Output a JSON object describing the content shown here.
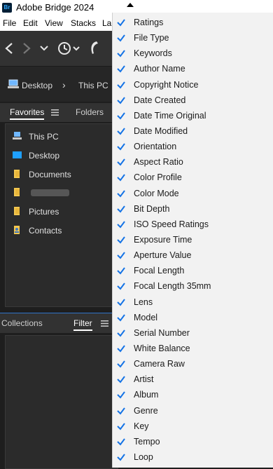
{
  "app": {
    "title": "Adobe Bridge 2024",
    "icon_text": "Br"
  },
  "menubar": {
    "items": [
      "File",
      "Edit",
      "View",
      "Stacks",
      "La"
    ]
  },
  "toolbar": {
    "icons": [
      "back-arrow-icon",
      "forward-arrow-icon",
      "chevron-down-icon",
      "history-icon",
      "boomerang-icon"
    ]
  },
  "path": {
    "desktop": "Desktop",
    "separator": "›",
    "this_pc": "This PC"
  },
  "panels": {
    "favorites_tab": "Favorites",
    "folders_tab": "Folders",
    "collections_tab": "Collections",
    "filter_tab": "Filter"
  },
  "favorites": [
    {
      "label": "This PC",
      "icon": "computer-icon"
    },
    {
      "label": "Desktop",
      "icon": "desktop-icon"
    },
    {
      "label": "Documents",
      "icon": "folder-icon"
    },
    {
      "label": "",
      "icon": "folder-icon"
    },
    {
      "label": "Pictures",
      "icon": "folder-icon"
    },
    {
      "label": "Contacts",
      "icon": "contacts-icon"
    }
  ],
  "dropdown": {
    "items": [
      "Ratings",
      "File Type",
      "Keywords",
      "Author Name",
      "Copyright Notice",
      "Date Created",
      "Date Time Original",
      "Date Modified",
      "Orientation",
      "Aspect Ratio",
      "Color Profile",
      "Color Mode",
      "Bit Depth",
      "ISO Speed Ratings",
      "Exposure Time",
      "Aperture Value",
      "Focal Length",
      "Focal Length 35mm",
      "Lens",
      "Model",
      "Serial Number",
      "White Balance",
      "Camera Raw",
      "Artist",
      "Album",
      "Genre",
      "Key",
      "Tempo",
      "Loop"
    ],
    "check_color": "#1473e6"
  },
  "colors": {
    "dark_bg": "#1e1e1e",
    "panel": "#2b2b2b",
    "accent": "#2f73c9",
    "menu_bg": "#f2f2f2"
  }
}
